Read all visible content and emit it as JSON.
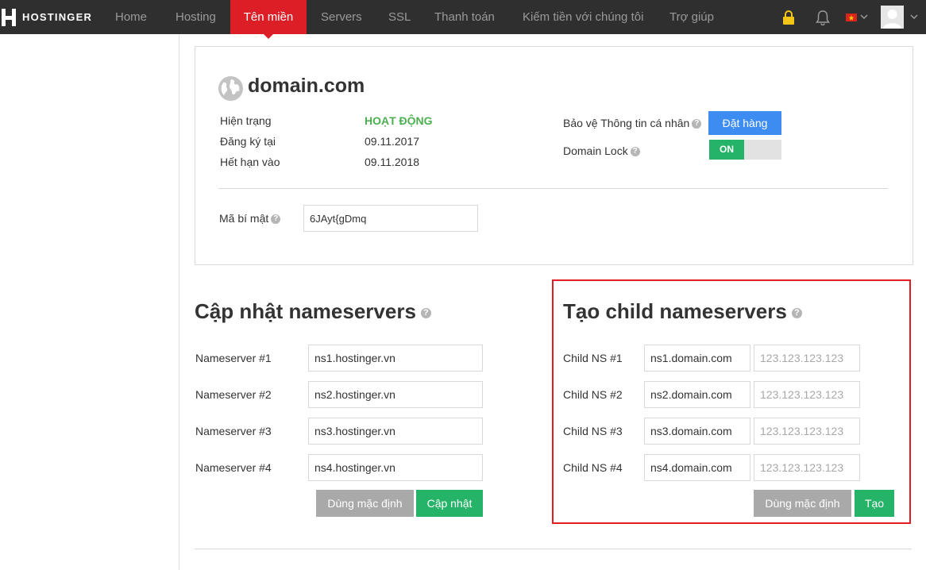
{
  "nav": {
    "brand": "HOSTINGER",
    "items": [
      {
        "label": "Home"
      },
      {
        "label": "Hosting"
      },
      {
        "label": "Tên miền"
      },
      {
        "label": "Servers"
      },
      {
        "label": "SSL"
      },
      {
        "label": "Thanh toán"
      },
      {
        "label": "Kiếm tiền với chúng tôi"
      },
      {
        "label": "Trợ giúp"
      }
    ],
    "active_index": 2,
    "icons": [
      "lock-icon",
      "bell-icon",
      "flag-vn-icon",
      "chevron-down-icon",
      "avatar",
      "chevron-down-icon"
    ]
  },
  "domain": {
    "name": "domain.com",
    "status_label": "Hiện trạng",
    "status_value": "HOẠT ĐỘNG",
    "registered_label": "Đăng ký tại",
    "registered_value": "09.11.2017",
    "expires_label": "Hết hạn vào",
    "expires_value": "09.11.2018",
    "privacy_label": "Bảo vệ Thông tin cá nhân",
    "privacy_button": "Đặt hàng",
    "lock_label": "Domain Lock",
    "lock_state": "ON",
    "secret_label": "Mã bí mật",
    "secret_value": "6JAyt{gDmq"
  },
  "nameservers": {
    "title": "Cập nhật nameservers",
    "rows": [
      {
        "label": "Nameserver #1",
        "value": "ns1.hostinger.vn"
      },
      {
        "label": "Nameserver #2",
        "value": "ns2.hostinger.vn"
      },
      {
        "label": "Nameserver #3",
        "value": "ns3.hostinger.vn"
      },
      {
        "label": "Nameserver #4",
        "value": "ns4.hostinger.vn"
      }
    ],
    "default_button": "Dùng mặc định",
    "update_button": "Cập nhật"
  },
  "child_ns": {
    "title": "Tạo child nameservers",
    "rows": [
      {
        "label": "Child NS #1",
        "host": "ns1.domain.com",
        "ip_placeholder": "123.123.123.123"
      },
      {
        "label": "Child NS #2",
        "host": "ns2.domain.com",
        "ip_placeholder": "123.123.123.123"
      },
      {
        "label": "Child NS #3",
        "host": "ns3.domain.com",
        "ip_placeholder": "123.123.123.123"
      },
      {
        "label": "Child NS #4",
        "host": "ns4.domain.com",
        "ip_placeholder": "123.123.123.123"
      }
    ],
    "default_button": "Dùng mặc định",
    "create_button": "Tạo"
  },
  "colors": {
    "nav_bg": "#2f2f2f",
    "nav_active": "#dc1f26",
    "status_green": "#4caf50",
    "primary_blue": "#3d8cf2",
    "action_green": "#25b367",
    "highlight_red": "#e31c24"
  }
}
